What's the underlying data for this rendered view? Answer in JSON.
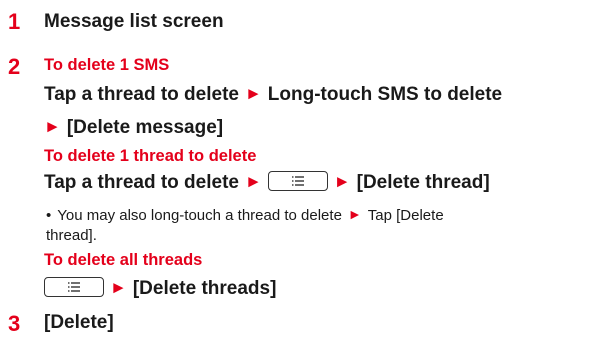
{
  "step1": {
    "number": "1",
    "text": "Message list screen"
  },
  "step2": {
    "number": "2",
    "sub1_title": "To delete 1 SMS",
    "sub1_line1_a": "Tap a thread to delete",
    "sub1_line1_b": "Long-touch SMS to delete",
    "sub1_line2": "[Delete message]",
    "sub2_title": "To delete 1 thread to delete",
    "sub2_line_a": "Tap a thread to delete",
    "sub2_line_b": "[Delete thread]",
    "note_bullet": "•",
    "note_line1_a": "You may also long-touch a thread to delete",
    "note_line1_b": "Tap [Delete",
    "note_line2": "thread].",
    "sub3_title": "To delete all threads",
    "sub3_line": "[Delete threads]"
  },
  "step3": {
    "number": "3",
    "text": "[Delete]"
  },
  "arrow_glyph": "►",
  "icons": {
    "menu_key": "menu-key-icon"
  },
  "colors": {
    "accent": "#e4001b",
    "text": "#1a1a1a"
  }
}
